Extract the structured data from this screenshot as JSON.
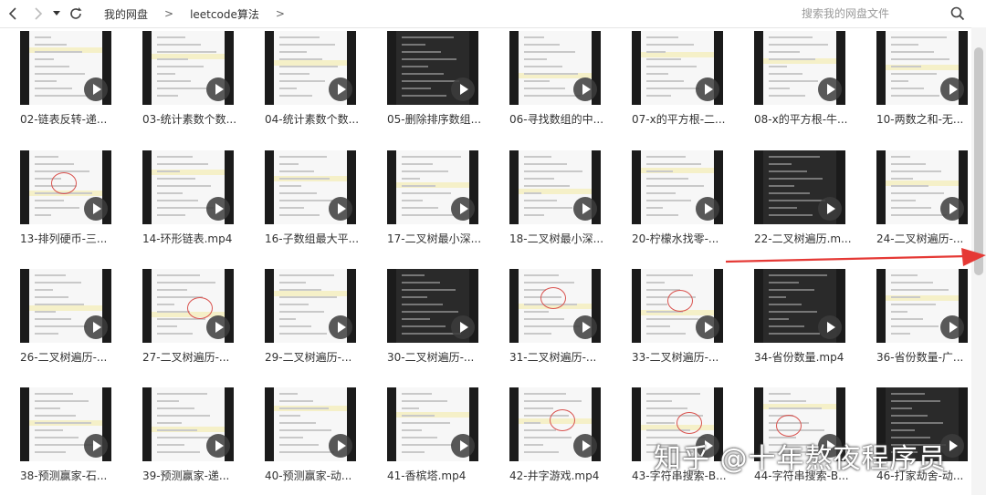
{
  "toolbar": {
    "back_icon": "chevron-left",
    "forward_icon": "chevron-right",
    "history_icon": "caret-down",
    "refresh_icon": "refresh"
  },
  "breadcrumb": {
    "items": [
      "我的网盘",
      "leetcode算法"
    ],
    "separator": ">"
  },
  "search": {
    "placeholder": "搜索我的网盘文件"
  },
  "files": [
    {
      "name": "02-链表反转-递..."
    },
    {
      "name": "03-统计素数个数..."
    },
    {
      "name": "04-统计素数个数..."
    },
    {
      "name": "05-删除排序数组..."
    },
    {
      "name": "06-寻找数组的中..."
    },
    {
      "name": "07-x的平方根-二..."
    },
    {
      "name": "08-x的平方根-牛..."
    },
    {
      "name": "10-两数之和-无..."
    },
    {
      "name": "13-排列硬币-三..."
    },
    {
      "name": "14-环形链表.mp4"
    },
    {
      "name": "16-子数组最大平..."
    },
    {
      "name": "17-二叉树最小深..."
    },
    {
      "name": "18-二叉树最小深..."
    },
    {
      "name": "20-柠檬水找零-..."
    },
    {
      "name": "22-二叉树遍历.m..."
    },
    {
      "name": "24-二叉树遍历-..."
    },
    {
      "name": "26-二叉树遍历-..."
    },
    {
      "name": "27-二叉树遍历-..."
    },
    {
      "name": "29-二叉树遍历-..."
    },
    {
      "name": "30-二叉树遍历-..."
    },
    {
      "name": "31-二叉树遍历-..."
    },
    {
      "name": "33-二叉树遍历-..."
    },
    {
      "name": "34-省份数量.mp4"
    },
    {
      "name": "36-省份数量-广..."
    },
    {
      "name": "38-预测赢家-石..."
    },
    {
      "name": "39-预测赢家-递..."
    },
    {
      "name": "40-预测赢家-动..."
    },
    {
      "name": "41-香槟塔.mp4"
    },
    {
      "name": "42-井字游戏.mp4"
    },
    {
      "name": "43-字符串搜索-B..."
    },
    {
      "name": "44-字符串搜索-B..."
    },
    {
      "name": "46-打家劫舍-动..."
    }
  ],
  "watermark": "知乎 @十年熬夜程序员",
  "colors": {
    "annotation_arrow": "#e53935",
    "play_button": "#3c3c3c"
  }
}
